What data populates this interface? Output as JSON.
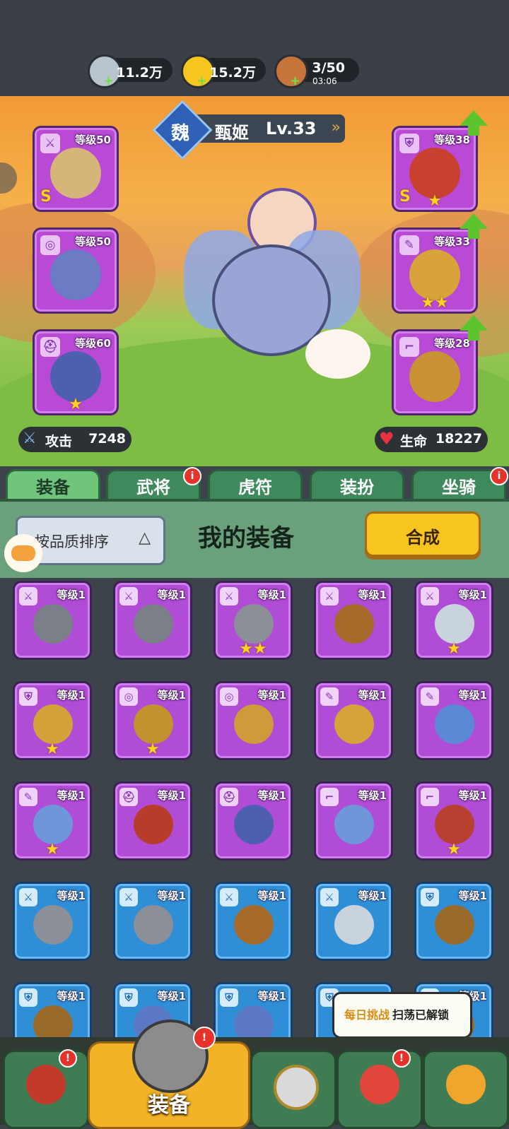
{
  "resources": [
    {
      "icon": "silver-coin-icon",
      "value": "11.2万"
    },
    {
      "icon": "gold-ingot-icon",
      "value": "15.2万"
    },
    {
      "icon": "meat-stamina-icon",
      "value": "3/50",
      "timer": "03:06"
    }
  ],
  "hero": {
    "faction": "魏",
    "name": "甄姬",
    "level": "Lv.33"
  },
  "equipped_left": [
    {
      "level": "等级50",
      "badge": "sword-icon",
      "grade": "S",
      "stars": ""
    },
    {
      "level": "等级50",
      "badge": "medal-icon",
      "grade": "",
      "stars": ""
    },
    {
      "level": "等级60",
      "badge": "helmet-icon",
      "grade": "",
      "stars": "★"
    }
  ],
  "equipped_right": [
    {
      "level": "等级38",
      "badge": "armor-icon",
      "grade": "S",
      "stars": "★"
    },
    {
      "level": "等级33",
      "badge": "bracer-icon",
      "grade": "",
      "stars": "★★"
    },
    {
      "level": "等级28",
      "badge": "boot-icon",
      "grade": "",
      "stars": ""
    }
  ],
  "stats": {
    "attack_label": "攻击",
    "attack_value": "7248",
    "hp_label": "生命",
    "hp_value": "18227"
  },
  "tabs": [
    {
      "label": "装备",
      "active": true,
      "badge": ""
    },
    {
      "label": "武将",
      "active": false,
      "badge": "i"
    },
    {
      "label": "虎符",
      "active": false,
      "badge": ""
    },
    {
      "label": "装扮",
      "active": false,
      "badge": ""
    },
    {
      "label": "坐骑",
      "active": false,
      "badge": "i"
    }
  ],
  "panel": {
    "sort_label": "按品质排序",
    "sort_arrow": "△",
    "title": "我的装备",
    "merge_label": "合成"
  },
  "inventory": [
    {
      "level": "等级1",
      "rarity": "purple",
      "stars": ""
    },
    {
      "level": "等级1",
      "rarity": "purple",
      "stars": ""
    },
    {
      "level": "等级1",
      "rarity": "purple",
      "stars": "★★"
    },
    {
      "level": "等级1",
      "rarity": "purple",
      "stars": ""
    },
    {
      "level": "等级1",
      "rarity": "purple",
      "stars": "★"
    },
    {
      "level": "等级1",
      "rarity": "purple",
      "stars": "★"
    },
    {
      "level": "等级1",
      "rarity": "purple",
      "stars": "★"
    },
    {
      "level": "等级1",
      "rarity": "purple",
      "stars": ""
    },
    {
      "level": "等级1",
      "rarity": "purple",
      "stars": ""
    },
    {
      "level": "等级1",
      "rarity": "purple",
      "stars": ""
    },
    {
      "level": "等级1",
      "rarity": "purple",
      "stars": "★"
    },
    {
      "level": "等级1",
      "rarity": "purple",
      "stars": ""
    },
    {
      "level": "等级1",
      "rarity": "purple",
      "stars": ""
    },
    {
      "level": "等级1",
      "rarity": "purple",
      "stars": ""
    },
    {
      "level": "等级1",
      "rarity": "purple",
      "stars": "★"
    },
    {
      "level": "等级1",
      "rarity": "blue",
      "stars": ""
    },
    {
      "level": "等级1",
      "rarity": "blue",
      "stars": ""
    },
    {
      "level": "等级1",
      "rarity": "blue",
      "stars": ""
    },
    {
      "level": "等级1",
      "rarity": "blue",
      "stars": ""
    },
    {
      "level": "等级1",
      "rarity": "blue",
      "stars": ""
    },
    {
      "level": "等级1",
      "rarity": "blue",
      "stars": ""
    },
    {
      "level": "等级1",
      "rarity": "blue",
      "stars": ""
    },
    {
      "level": "等级1",
      "rarity": "blue",
      "stars": ""
    },
    {
      "level": "",
      "rarity": "blue",
      "stars": ""
    },
    {
      "level": "等级1",
      "rarity": "blue",
      "stars": ""
    }
  ],
  "tooltip": {
    "highlight": "每日挑战",
    "text": "扫荡已解锁"
  },
  "bottom_nav": {
    "active_label": "装备"
  },
  "colors": {
    "purple": "#b04cd5",
    "blue": "#2f8fd6",
    "merge": "#f7c420",
    "green_tab": "#3f8a5c"
  }
}
